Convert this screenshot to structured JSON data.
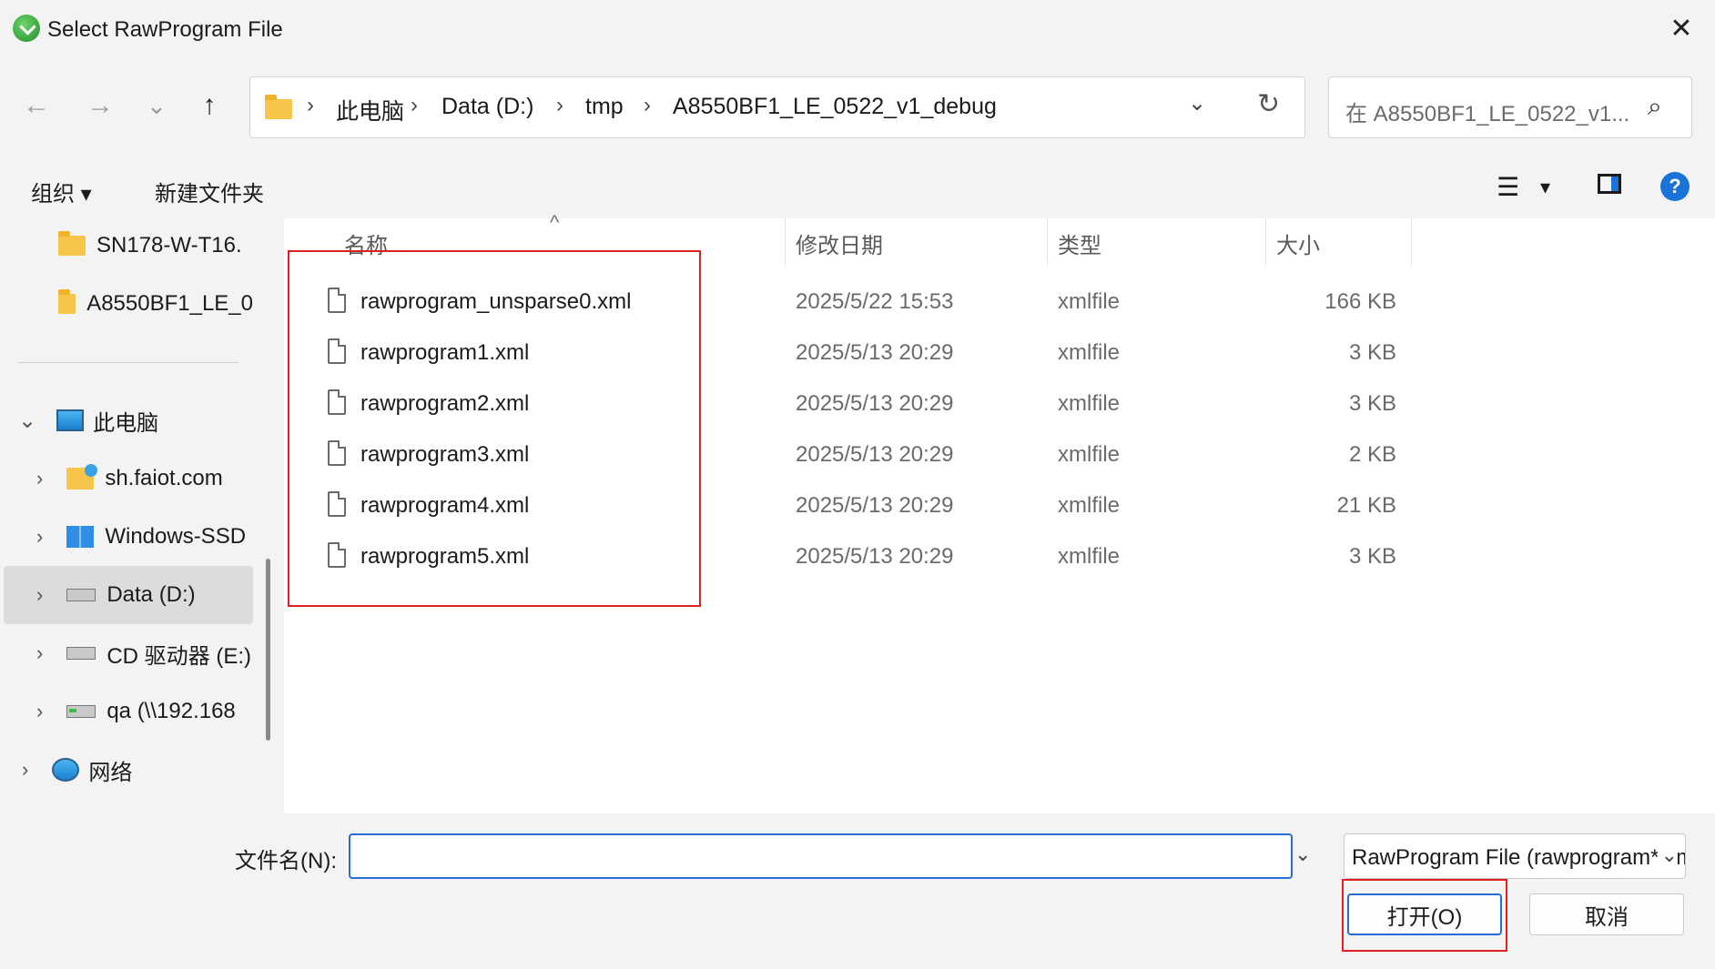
{
  "window": {
    "title": "Select RawProgram File",
    "close_glyph": "✕"
  },
  "nav": {
    "back": "←",
    "forward": "→",
    "recent": "⌄",
    "up": "↑"
  },
  "address": {
    "crumbs": [
      "此电脑",
      "Data (D:)",
      "tmp",
      "A8550BF1_LE_0522_v1_debug"
    ],
    "separator": "›",
    "dropdown": "⌄",
    "refresh": "↻"
  },
  "search": {
    "placeholder": "在 A8550BF1_LE_0522_v1...",
    "icon": "⌕"
  },
  "toolbar": {
    "organize": "组织 ▾",
    "new_folder": "新建文件夹",
    "view_icon": "☰",
    "view_dd": "▾",
    "help": "?"
  },
  "sidebar": {
    "items": [
      {
        "label": "SN178-W-T16.",
        "icon": "folder-icon"
      },
      {
        "label": "A8550BF1_LE_0",
        "icon": "folder-icon"
      },
      {
        "label": "此电脑",
        "icon": "computer-icon",
        "chevron": "⌄"
      },
      {
        "label": "sh.faiot.com",
        "icon": "network-share-icon",
        "chevron": "›"
      },
      {
        "label": "Windows-SSD",
        "icon": "windows-drive-icon",
        "chevron": "›"
      },
      {
        "label": "Data (D:)",
        "icon": "drive-icon",
        "chevron": "›"
      },
      {
        "label": "CD 驱动器 (E:)",
        "icon": "cd-drive-icon",
        "chevron": "›"
      },
      {
        "label": "qa (\\\\192.168",
        "icon": "network-drive-icon",
        "chevron": "›"
      },
      {
        "label": "网络",
        "icon": "network-icon",
        "chevron": "›"
      }
    ]
  },
  "filelist": {
    "sort_arrow": "^",
    "columns": [
      "名称",
      "修改日期",
      "类型",
      "大小"
    ],
    "rows": [
      {
        "name": "rawprogram_unsparse0.xml",
        "date": "2025/5/22 15:53",
        "type": "xmlfile",
        "size": "166 KB"
      },
      {
        "name": "rawprogram1.xml",
        "date": "2025/5/13 20:29",
        "type": "xmlfile",
        "size": "3 KB"
      },
      {
        "name": "rawprogram2.xml",
        "date": "2025/5/13 20:29",
        "type": "xmlfile",
        "size": "3 KB"
      },
      {
        "name": "rawprogram3.xml",
        "date": "2025/5/13 20:29",
        "type": "xmlfile",
        "size": "2 KB"
      },
      {
        "name": "rawprogram4.xml",
        "date": "2025/5/13 20:29",
        "type": "xmlfile",
        "size": "21 KB"
      },
      {
        "name": "rawprogram5.xml",
        "date": "2025/5/13 20:29",
        "type": "xmlfile",
        "size": "3 KB"
      }
    ]
  },
  "footer": {
    "filename_label": "文件名(N):",
    "filename_value": "",
    "filename_dd": "⌄",
    "filter_value": "RawProgram File (rawprogram*.xml)",
    "filter_dd": "⌄",
    "open": "打开(O)",
    "cancel": "取消"
  },
  "colors": {
    "accent": "#2a6cd6",
    "highlight_box": "#e02020",
    "folder": "#f7c54a"
  }
}
